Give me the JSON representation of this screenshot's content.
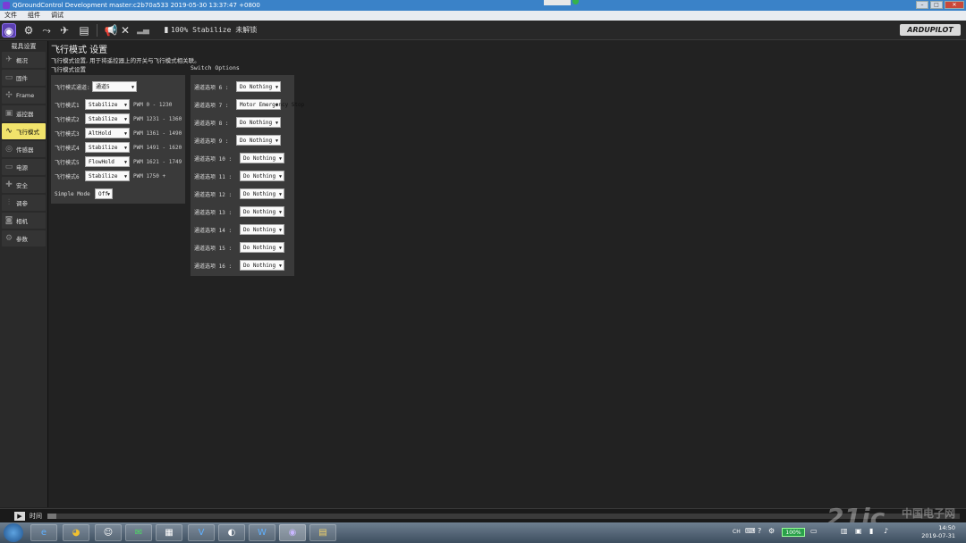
{
  "window": {
    "title": "QGroundControl Development master:c2b70a533 2019-05-30 13:37:47 +0800"
  },
  "menu": [
    "文件",
    "组件",
    "调试"
  ],
  "toolbar": {
    "status_text": "100% Stabilize 未解锁",
    "brand": "ARDUPILOT"
  },
  "sidebar": {
    "title": "载具设置",
    "items": [
      {
        "label": "概况",
        "icon": "plane-icon"
      },
      {
        "label": "固件",
        "icon": "firmware-icon"
      },
      {
        "label": "Frame",
        "icon": "frame-icon"
      },
      {
        "label": "遥控器",
        "icon": "radio-icon"
      },
      {
        "label": "飞行模式",
        "icon": "wave-icon",
        "active": true
      },
      {
        "label": "传感器",
        "icon": "sensor-icon"
      },
      {
        "label": "电源",
        "icon": "battery-icon"
      },
      {
        "label": "安全",
        "icon": "safety-icon"
      },
      {
        "label": "调参",
        "icon": "tuning-icon"
      },
      {
        "label": "相机",
        "icon": "camera-icon"
      },
      {
        "label": "参数",
        "icon": "gear-icon"
      }
    ]
  },
  "main": {
    "title": "飞行模式 设置",
    "description": "飞行模式设置, 用于将遥控器上的开关与飞行模式相关联。",
    "flight_modes_section": "飞行模式设置",
    "switch_options_section": "Switch Options",
    "channel_label": "飞行模式通道:",
    "channel_value": "通道5",
    "modes": [
      {
        "label": "飞行模式1",
        "value": "Stabilize",
        "pwm": "PWM 0 - 1230"
      },
      {
        "label": "飞行模式2",
        "value": "Stabilize",
        "pwm": "PWM 1231 - 1360"
      },
      {
        "label": "飞行模式3",
        "value": "AltHold",
        "pwm": "PWM 1361 - 1490"
      },
      {
        "label": "飞行模式4",
        "value": "Stabilize",
        "pwm": "PWM 1491 - 1620"
      },
      {
        "label": "飞行模式5",
        "value": "FlowHold",
        "pwm": "PWM 1621 - 1749"
      },
      {
        "label": "飞行模式6",
        "value": "Stabilize",
        "pwm": "PWM 1750 +"
      }
    ],
    "simple_mode_label": "Simple Mode",
    "simple_mode_value": "Off",
    "switch_options": [
      {
        "label": "通道选项 6 :",
        "value": "Do Nothing"
      },
      {
        "label": "通道选项 7 :",
        "value": "Motor Emergency Stop"
      },
      {
        "label": "通道选项 8 :",
        "value": "Do Nothing"
      },
      {
        "label": "通道选项 9 :",
        "value": "Do Nothing"
      },
      {
        "label": "通道选项 10 :",
        "value": "Do Nothing"
      },
      {
        "label": "通道选项 11 :",
        "value": "Do Nothing"
      },
      {
        "label": "通道选项 12 :",
        "value": "Do Nothing"
      },
      {
        "label": "通道选项 13 :",
        "value": "Do Nothing"
      },
      {
        "label": "通道选项 14 :",
        "value": "Do Nothing"
      },
      {
        "label": "通道选项 15 :",
        "value": "Do Nothing"
      },
      {
        "label": "通道选项 16 :",
        "value": "Do Nothing"
      }
    ]
  },
  "timeline": {
    "label": "时间"
  },
  "taskbar": {
    "battery_percent": "100%",
    "time": "14:50",
    "date": "2019-07-31",
    "lang": "CH"
  },
  "watermark": {
    "main": "21ic",
    "sub": "中国电子网"
  }
}
